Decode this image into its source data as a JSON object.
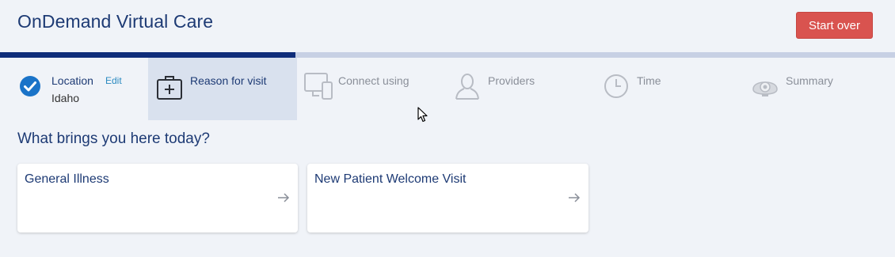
{
  "header": {
    "app_title": "OnDemand Virtual Care",
    "start_over_label": "Start over"
  },
  "progress": {
    "completed_fraction": 0.33,
    "fill_color": "#0f2d7a",
    "track_color": "#c7d0e4"
  },
  "steps": [
    {
      "label": "Location",
      "state": "done",
      "icon": "check-circle-icon",
      "edit_label": "Edit",
      "value": "Idaho"
    },
    {
      "label": "Reason for visit",
      "state": "active",
      "icon": "first-aid-kit-icon"
    },
    {
      "label": "Connect using",
      "state": "future",
      "icon": "devices-icon"
    },
    {
      "label": "Providers",
      "state": "future",
      "icon": "person-icon"
    },
    {
      "label": "Time",
      "state": "future",
      "icon": "clock-icon"
    },
    {
      "label": "Summary",
      "state": "future",
      "icon": "webcam-icon"
    }
  ],
  "main": {
    "question": "What brings you here today?",
    "options": [
      {
        "label": "General Illness",
        "icon": "arrow-right-icon"
      },
      {
        "label": "New Patient Welcome Visit",
        "icon": "arrow-right-icon"
      }
    ]
  },
  "colors": {
    "primary_text": "#1d3a74",
    "accent_button": "#d9534f",
    "link": "#2a8ac0",
    "check": "#1a73c8",
    "inactive": "#b8bcc4"
  }
}
